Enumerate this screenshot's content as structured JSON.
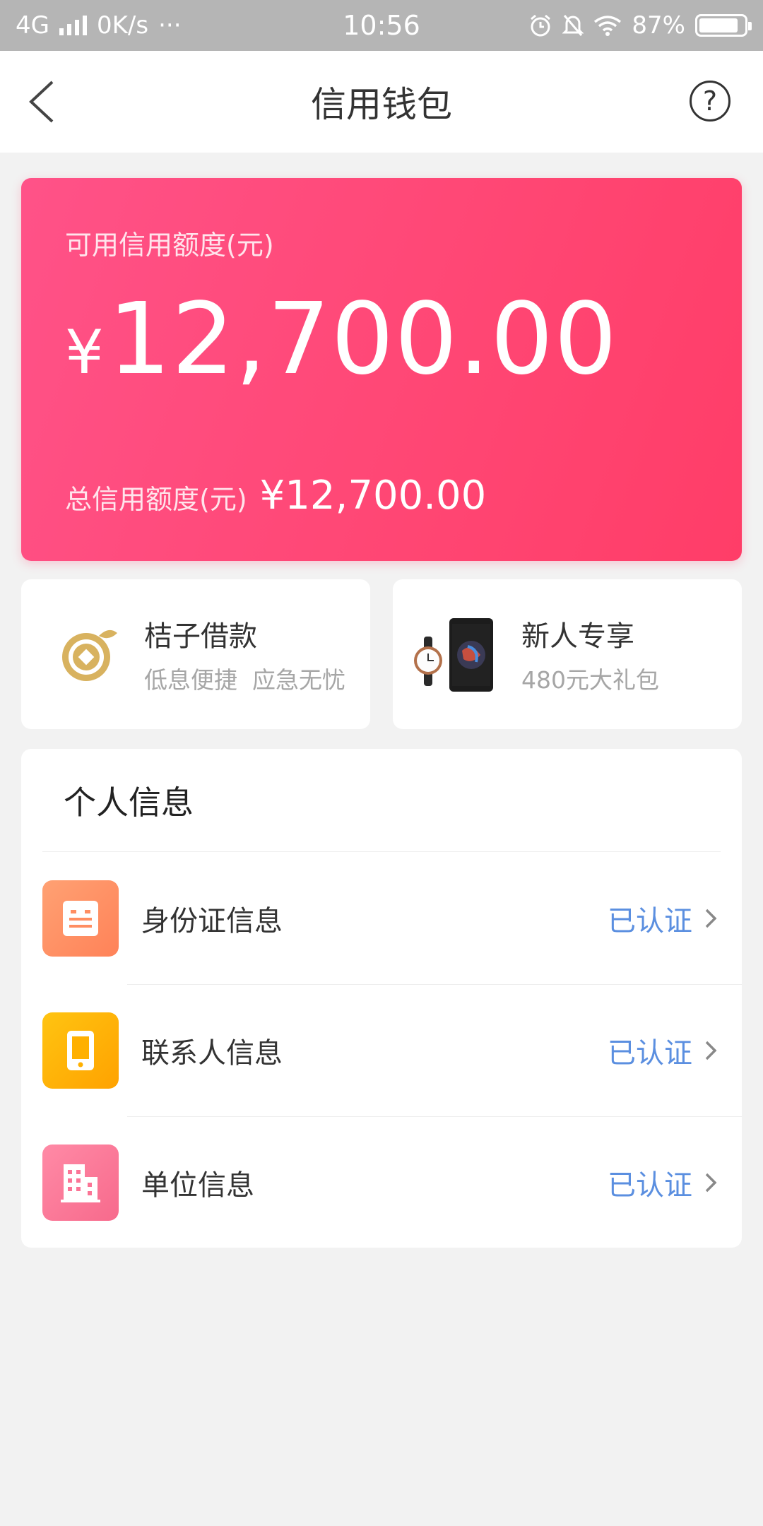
{
  "status_bar": {
    "network": "4G",
    "speed": "0K/s",
    "more": "···",
    "time": "10:56",
    "battery": "87%",
    "battery_level": 0.87
  },
  "header": {
    "title": "信用钱包",
    "help_label": "?"
  },
  "credit": {
    "available_label": "可用信用额度(元)",
    "currency": "¥",
    "available_amount": "12,700.00",
    "total_label": "总信用额度(元)",
    "total_amount": "¥12,700.00",
    "gradient_start": "#ff5288",
    "gradient_end": "#ff3d68"
  },
  "promos": [
    {
      "title": "桔子借款",
      "subtitle": "低息便捷  应急无忧",
      "icon": "orange-coin-icon"
    },
    {
      "title": "新人专享",
      "subtitle": "480元大礼包",
      "icon": "gift-products-icon"
    }
  ],
  "personal_info": {
    "title": "个人信息",
    "items": [
      {
        "label": "身份证信息",
        "status": "已认证",
        "icon": "id-card-icon",
        "color": "#ff8e62"
      },
      {
        "label": "联系人信息",
        "status": "已认证",
        "icon": "phone-icon",
        "color": "#ffb000"
      },
      {
        "label": "单位信息",
        "status": "已认证",
        "icon": "building-icon",
        "color": "#fb7596"
      }
    ],
    "status_color": "#5b8fe0"
  }
}
